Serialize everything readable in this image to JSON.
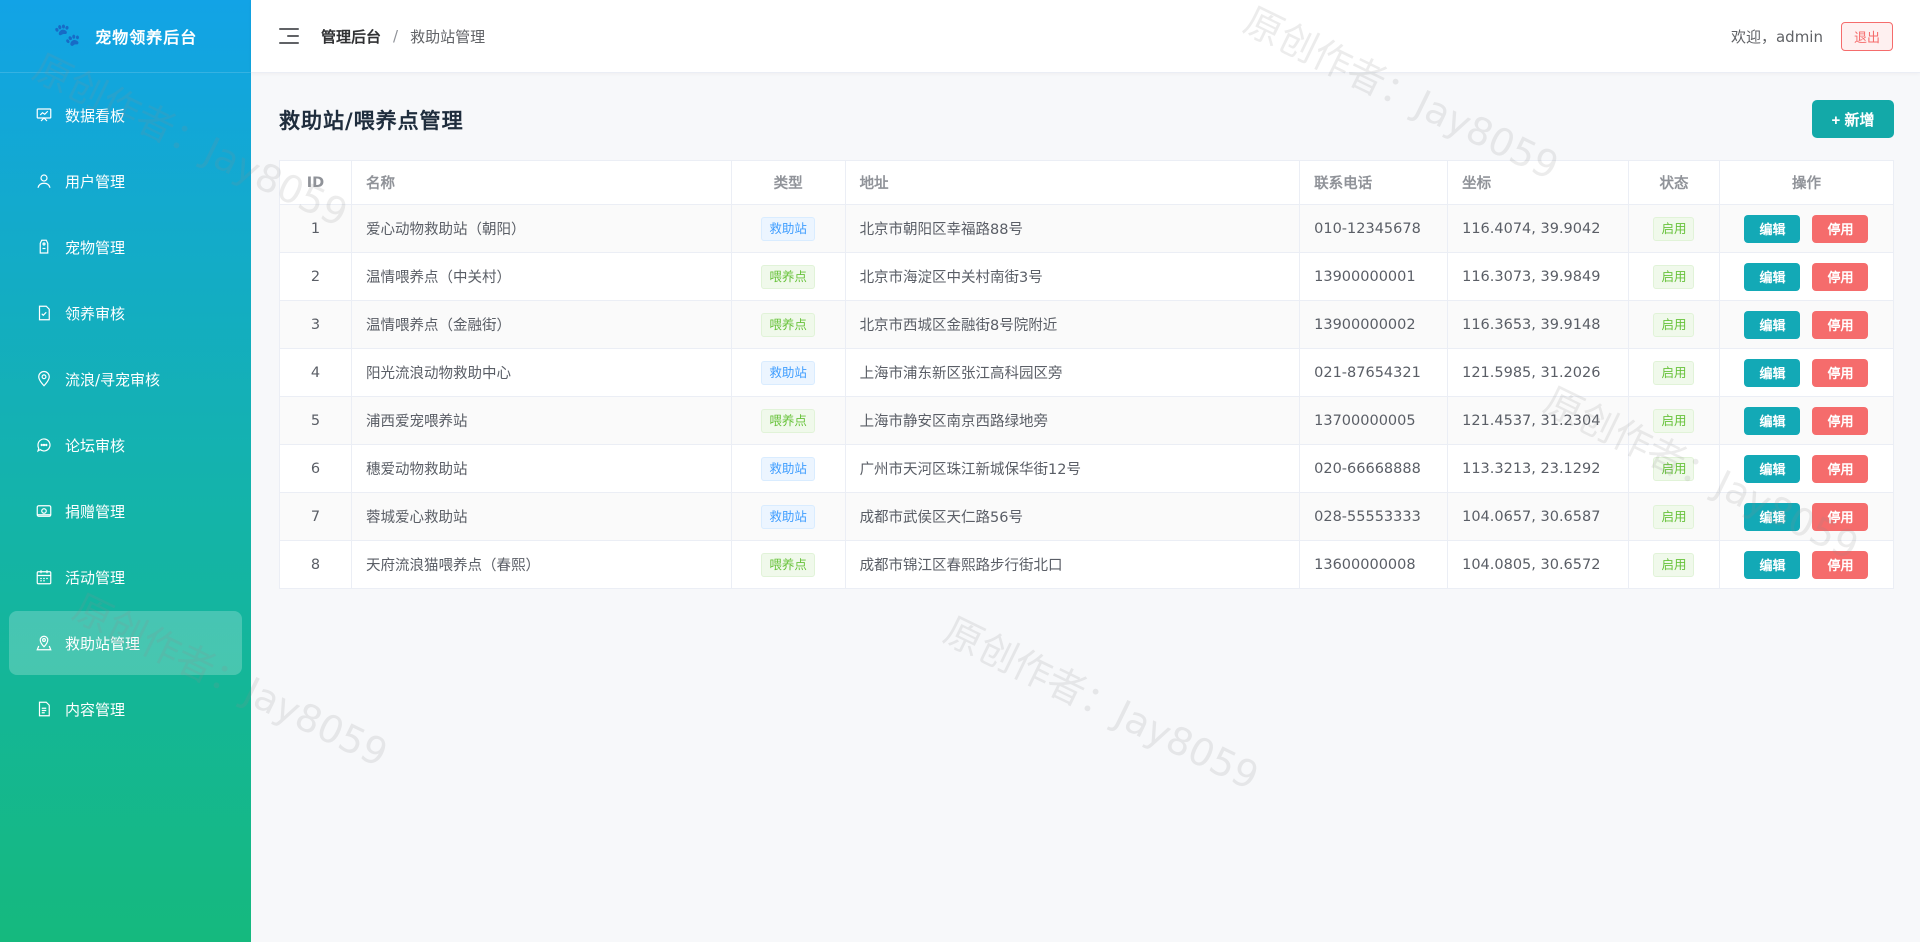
{
  "brand": {
    "title": "宠物领养后台",
    "icon": "paw-icon"
  },
  "sidebar": {
    "items": [
      {
        "label": "数据看板",
        "icon": "dashboard-icon",
        "active": false
      },
      {
        "label": "用户管理",
        "icon": "user-icon",
        "active": false
      },
      {
        "label": "宠物管理",
        "icon": "tag-icon",
        "active": false
      },
      {
        "label": "领养审核",
        "icon": "document-check-icon",
        "active": false
      },
      {
        "label": "流浪/寻宠审核",
        "icon": "location-icon",
        "active": false
      },
      {
        "label": "论坛审核",
        "icon": "chat-icon",
        "active": false
      },
      {
        "label": "捐赠管理",
        "icon": "wallet-icon",
        "active": false
      },
      {
        "label": "活动管理",
        "icon": "calendar-icon",
        "active": false
      },
      {
        "label": "救助站管理",
        "icon": "map-pin-icon",
        "active": true
      },
      {
        "label": "内容管理",
        "icon": "file-icon",
        "active": false
      }
    ]
  },
  "header": {
    "breadcrumb_root": "管理后台",
    "breadcrumb_sep": "/",
    "breadcrumb_current": "救助站管理",
    "welcome": "欢迎，admin",
    "logout": "退出"
  },
  "main": {
    "title": "救助站/喂养点管理",
    "add_button": "+ 新增",
    "table": {
      "headers": [
        "ID",
        "名称",
        "类型",
        "地址",
        "联系电话",
        "坐标",
        "状态",
        "操作"
      ],
      "edit_label": "编辑",
      "stop_label": "停用",
      "rows": [
        {
          "id": "1",
          "name": "爱心动物救助站（朝阳）",
          "type": "救助站",
          "type_kind": "rescue",
          "address": "北京市朝阳区幸福路88号",
          "phone": "010-12345678",
          "coord": "116.4074, 39.9042",
          "status": "启用"
        },
        {
          "id": "2",
          "name": "温情喂养点（中关村）",
          "type": "喂养点",
          "type_kind": "feed",
          "address": "北京市海淀区中关村南街3号",
          "phone": "13900000001",
          "coord": "116.3073, 39.9849",
          "status": "启用"
        },
        {
          "id": "3",
          "name": "温情喂养点（金融街）",
          "type": "喂养点",
          "type_kind": "feed",
          "address": "北京市西城区金融街8号院附近",
          "phone": "13900000002",
          "coord": "116.3653, 39.9148",
          "status": "启用"
        },
        {
          "id": "4",
          "name": "阳光流浪动物救助中心",
          "type": "救助站",
          "type_kind": "rescue",
          "address": "上海市浦东新区张江高科园区旁",
          "phone": "021-87654321",
          "coord": "121.5985, 31.2026",
          "status": "启用"
        },
        {
          "id": "5",
          "name": "浦西爱宠喂养站",
          "type": "喂养点",
          "type_kind": "feed",
          "address": "上海市静安区南京西路绿地旁",
          "phone": "13700000005",
          "coord": "121.4537, 31.2304",
          "status": "启用"
        },
        {
          "id": "6",
          "name": "穗爱动物救助站",
          "type": "救助站",
          "type_kind": "rescue",
          "address": "广州市天河区珠江新城保华街12号",
          "phone": "020-66668888",
          "coord": "113.3213, 23.1292",
          "status": "启用"
        },
        {
          "id": "7",
          "name": "蓉城爱心救助站",
          "type": "救助站",
          "type_kind": "rescue",
          "address": "成都市武侯区天仁路56号",
          "phone": "028-55553333",
          "coord": "104.0657, 30.6587",
          "status": "启用"
        },
        {
          "id": "8",
          "name": "天府流浪猫喂养点（春熙）",
          "type": "喂养点",
          "type_kind": "feed",
          "address": "成都市锦江区春熙路步行街北口",
          "phone": "13600000008",
          "coord": "104.0805, 30.6572",
          "status": "启用"
        }
      ]
    }
  },
  "watermark": "原创作者：Jay8059"
}
